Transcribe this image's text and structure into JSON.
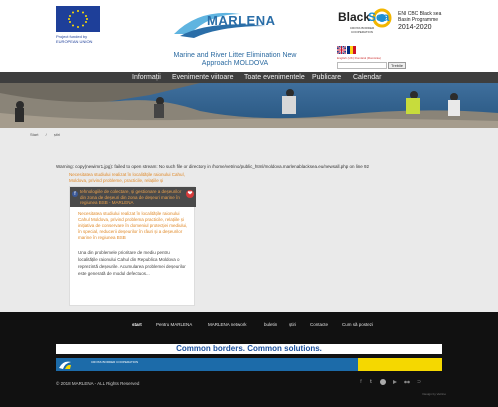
{
  "header": {
    "eu_caption_1": "Project funded by",
    "eu_caption_2": "EUROPEAN UNION",
    "logo_word": "MARLENA",
    "site_title_1": "Marine and River Litter Elimination New",
    "site_title_2": "Approach MOLDOVA",
    "bs_black": "Black",
    "bs_sea": "Sea",
    "bs_coop": "CROSS BORDER COOPERATION",
    "bs_prog_1": "ENI CBC Black sea",
    "bs_prog_2": "Basin Programme",
    "bs_prog_3": "2014-2020",
    "lang_links": "English (UK)  Română (România)",
    "search_button": "Trebiie"
  },
  "nav": {
    "items": [
      "Informații",
      "Evenimente viitoare",
      "Toate evenimentele",
      "Publicare",
      "Calendar"
    ]
  },
  "breadcrumb": {
    "home": "Start",
    "separator": "/",
    "current": "știri"
  },
  "content": {
    "warning": "Warning: copy(newimr1.jpg): failed to open stream: No such file or directory in /home/vetrino/public_html/moldova.marlenablacksea.eu/newsall.php on line 92",
    "card": {
      "link_top": "Necesitatea studiului realizat în localitățile raionului Cahul, Moldova, privind probleme, practicile, relațiile și",
      "bar_text": "tehnologiile de colectare, și gestionare a deșeurilor din zona de deșeuri din zona de deșeuri marine în regiunea BSB - MARLENA",
      "title": "Necesitatea studiului realizat în localitățile raionului Cahul Moldova, privind problema practicile, relațiile și inițiativa de conservare în domeniul protecției mediului, în special, reducerii deșeurilor în râuri și a deșeurilor marine în regiunea BSB",
      "excerpt": "Una din problemele prioritare de mediu pentru localitățile raionului Cahul din Republica Moldova o reprezintă deșeurile. Acumularea problemei deșeurilor este generată de modul defectuos..."
    }
  },
  "footer": {
    "nav": [
      "start",
      "Pentru MARLENA",
      "MARLENA network",
      "buletin",
      "știri",
      "Contacte",
      "Cum să postezi"
    ],
    "cb_slogan": "Common borders. Common solutions.",
    "cb_coop": "CROSS BORDER COOPERATION",
    "copyright": "© 2018 MARLENA - ALL Rights Reserved",
    "designer": "Design by Vetrino"
  },
  "icons": {
    "facebook": "f",
    "heart": "❤",
    "twitter": "t",
    "rss": "⊃"
  },
  "colors": {
    "nav_bg": "#3e3e3e",
    "footer_bg": "#111111",
    "accent_orange": "#e08a2a",
    "cb_blue": "#1c6ba9",
    "cb_yellow": "#f5d800",
    "eu_blue": "#1e3f99"
  }
}
